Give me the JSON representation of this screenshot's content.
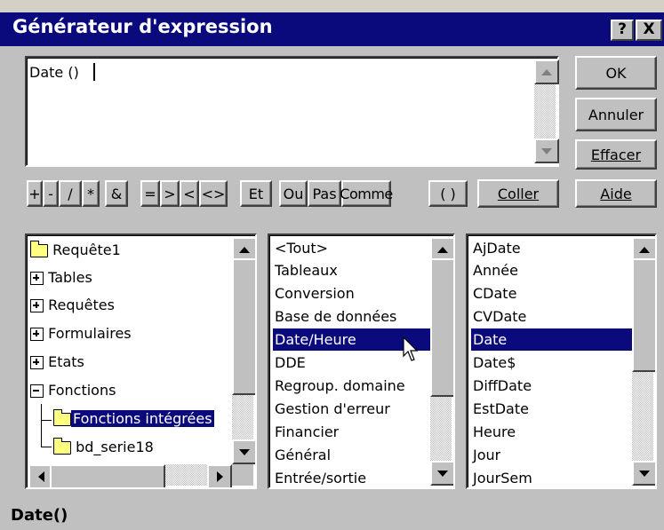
{
  "window": {
    "title": "Générateur d'expression",
    "help_button": "?",
    "close_button": "X"
  },
  "expression_box": {
    "value": "Date () "
  },
  "buttons": {
    "ok": "OK",
    "annuler": "Annuler",
    "effacer": "Effacer",
    "coller": "Coller",
    "aide": "Aide"
  },
  "operators": [
    "+",
    "-",
    "/",
    "*",
    "&",
    "=",
    ">",
    "<",
    "<>",
    "Et",
    "Ou",
    "Pas",
    "Comme",
    "( )"
  ],
  "tree": {
    "items": [
      {
        "label": "Requête1",
        "icon": "folder-icon"
      },
      {
        "label": "Tables",
        "icon": "expand-plus-icon"
      },
      {
        "label": "Requêtes",
        "icon": "expand-plus-icon"
      },
      {
        "label": "Formulaires",
        "icon": "expand-plus-icon"
      },
      {
        "label": "Etats",
        "icon": "expand-plus-icon"
      },
      {
        "label": "Fonctions",
        "icon": "collapse-minus-icon"
      },
      {
        "label": "Fonctions intégrées",
        "icon": "open-folder-icon",
        "selected": true
      },
      {
        "label": "bd_serie18",
        "icon": "folder-icon"
      }
    ]
  },
  "categories": {
    "items": [
      "<Tout>",
      "Tableaux",
      "Conversion",
      "Base de données",
      "Date/Heure",
      "DDE",
      "Regroup. domaine",
      "Gestion d'erreur",
      "Financier",
      "Général",
      "Entrée/sortie"
    ],
    "selected": "Date/Heure"
  },
  "functions": {
    "items": [
      "AjDate",
      "Année",
      "CDate",
      "CVDate",
      "Date",
      "Date$",
      "DiffDate",
      "EstDate",
      "Heure",
      "Jour",
      "JourSem"
    ],
    "selected": "Date"
  },
  "status": {
    "syntax": "Date()"
  },
  "colors": {
    "title_bar": "#0a0a7c",
    "selection": "#0a0a7c",
    "face": "#c0c0c0"
  }
}
